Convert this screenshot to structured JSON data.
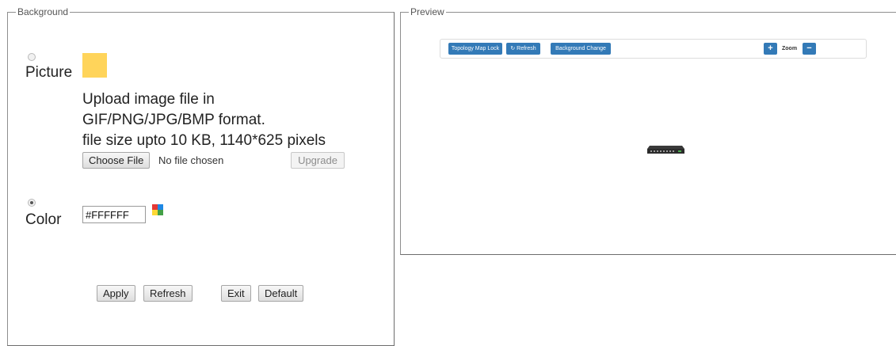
{
  "background_panel": {
    "legend": "Background",
    "picture_label": "Picture",
    "picture_selected": false,
    "picture_swatch_color": "#ffd45a",
    "upload_lines": [
      "Upload image file in",
      "GIF/PNG/JPG/BMP format.",
      "file size upto 10 KB, 1140*625 pixels"
    ],
    "choose_file_label": "Choose File",
    "no_file_text": "No file chosen",
    "upgrade_label": "Upgrade",
    "color_label": "Color",
    "color_selected": true,
    "color_value": "#FFFFFF",
    "palette_icon": "color-palette-icon",
    "buttons": {
      "apply": "Apply",
      "refresh": "Refresh",
      "exit": "Exit",
      "default": "Default"
    }
  },
  "preview_panel": {
    "legend": "Preview",
    "toolbar": {
      "lock_label": "Topology Map Lock",
      "refresh_label": "Refresh",
      "refresh_icon": "refresh-icon",
      "bg_change_label": "Background Change",
      "zoom_in_icon": "plus-icon",
      "zoom_label": "Zoom",
      "zoom_out_icon": "minus-icon",
      "accent_color": "#337ab7"
    },
    "device_icon": "network-switch-icon"
  }
}
